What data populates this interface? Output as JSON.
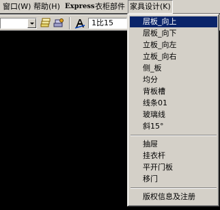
{
  "menubar": {
    "items": [
      {
        "label": "窗口(W)"
      },
      {
        "label": "帮助(H)"
      },
      {
        "label": "Express"
      },
      {
        "label": "衣柜部件"
      },
      {
        "label": "家具设计(K)"
      }
    ]
  },
  "toolbar": {
    "combo1_value": "",
    "combo2_value": "1比15",
    "icons": [
      "layer-stack-icon",
      "layer-tools-icon",
      "text-style-icon"
    ]
  },
  "dropdown": {
    "selected_index": 0,
    "groups": [
      [
        "层板_向上",
        "层板_向下",
        "立板_向左",
        "立板_向右",
        "侧_板",
        "均分",
        "背板槽",
        "线条01",
        "玻璃线",
        "斜15°"
      ],
      [
        "抽屉",
        "挂衣杆",
        "平开门板",
        "移门"
      ],
      [
        "版权信息及注册"
      ]
    ]
  },
  "colors": {
    "face": "#d4d0c8",
    "highlight": "#0a246a",
    "canvas": "#000000"
  }
}
